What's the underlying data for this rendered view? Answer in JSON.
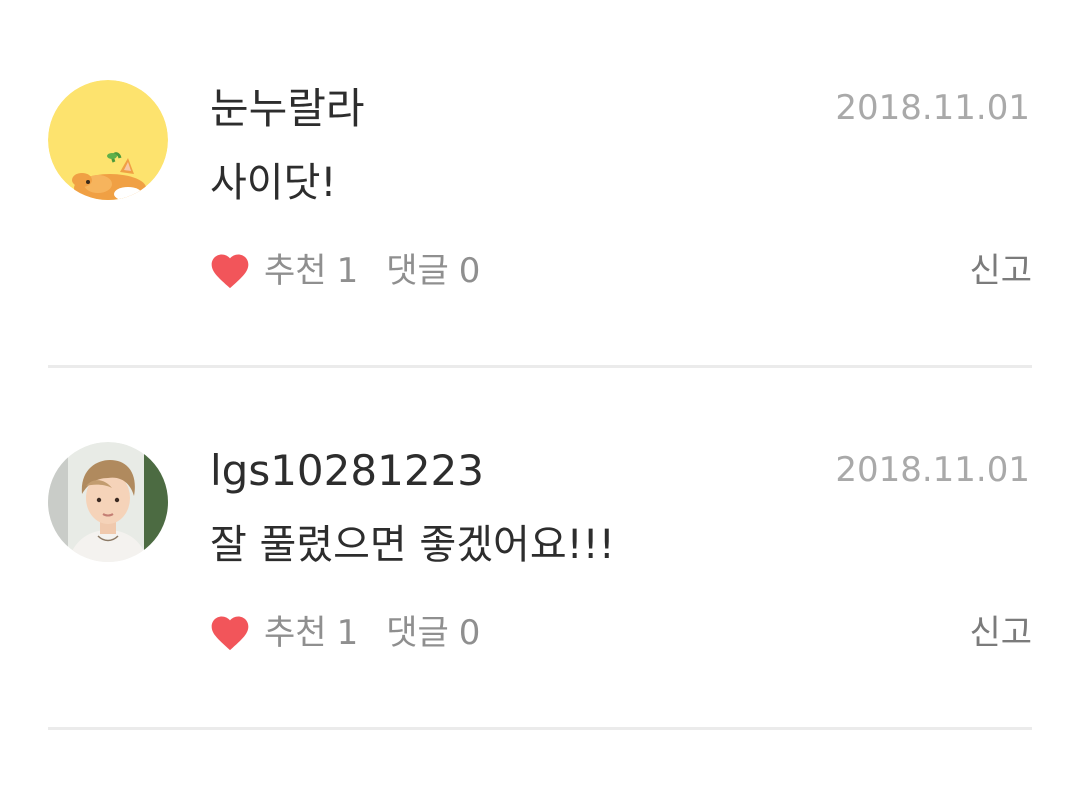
{
  "comments": [
    {
      "nickname": "눈누랄라",
      "date": "2018.11.01",
      "text": "사이닷!",
      "like_label": "추천",
      "like_count": "1",
      "reply_label": "댓글",
      "reply_count": "0",
      "report_label": "신고",
      "avatar": "yellow-corgi-avatar"
    },
    {
      "nickname": "lgs10281223",
      "date": "2018.11.01",
      "text": "잘 풀렸으면 좋겠어요!!!",
      "like_label": "추천",
      "like_count": "1",
      "reply_label": "댓글",
      "reply_count": "0",
      "report_label": "신고",
      "avatar": "person-photo-avatar"
    }
  ],
  "colors": {
    "heart": "#f2555a",
    "avatar_yellow": "#fde36e",
    "muted_text": "#8f8f8f",
    "date_text": "#a9a9a9",
    "divider": "#ebebeb"
  }
}
